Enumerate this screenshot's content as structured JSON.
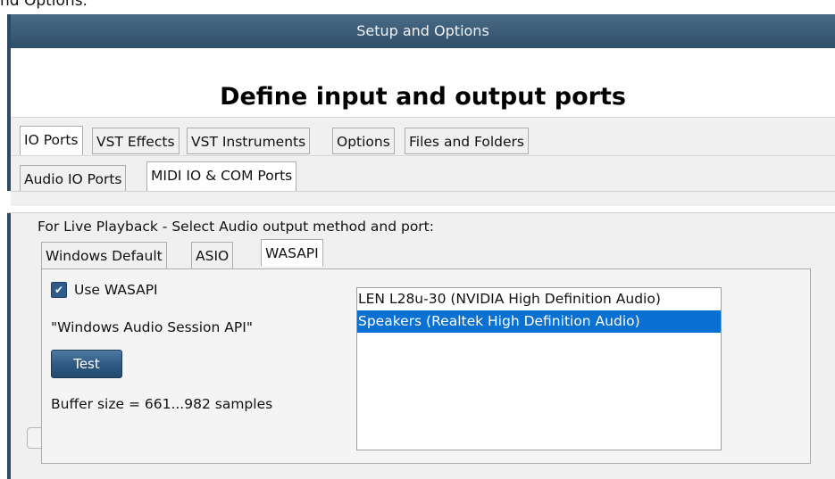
{
  "caption": "nd Options.",
  "window": {
    "title": "Setup and Options",
    "heading": "Define input and output ports"
  },
  "main_tabs": [
    {
      "label": "IO Ports",
      "active": true
    },
    {
      "label": "VST Effects",
      "active": false
    },
    {
      "label": "VST Instruments",
      "active": false
    },
    {
      "label": "Options",
      "active": false
    },
    {
      "label": "Files and Folders",
      "active": false
    }
  ],
  "sub_tabs": [
    {
      "label": "Audio IO Ports",
      "active": false
    },
    {
      "label": "MIDI IO & COM Ports",
      "active": true
    }
  ],
  "playback": {
    "prompt": "For Live Playback -  Select Audio output method and port:",
    "method_tabs": [
      {
        "label": "Windows Default",
        "active": false
      },
      {
        "label": "ASIO",
        "active": false
      },
      {
        "label": "WASAPI",
        "active": true
      }
    ],
    "use_wasapi": {
      "label": "Use WASAPI",
      "checked": true
    },
    "api_name": "\"Windows Audio Session API\"",
    "test_button": "Test",
    "buffer_size": "Buffer size =  661...982 samples",
    "ports": [
      {
        "name": "LEN L28u-30 (NVIDIA High Definition Audio)",
        "selected": false
      },
      {
        "name": "Speakers (Realtek High Definition Audio)",
        "selected": true
      }
    ]
  },
  "colors": {
    "titlebar": "#3d5f7b",
    "selection": "#0a70d1",
    "button": "#2f5a83",
    "frame": "#2c4a63"
  }
}
